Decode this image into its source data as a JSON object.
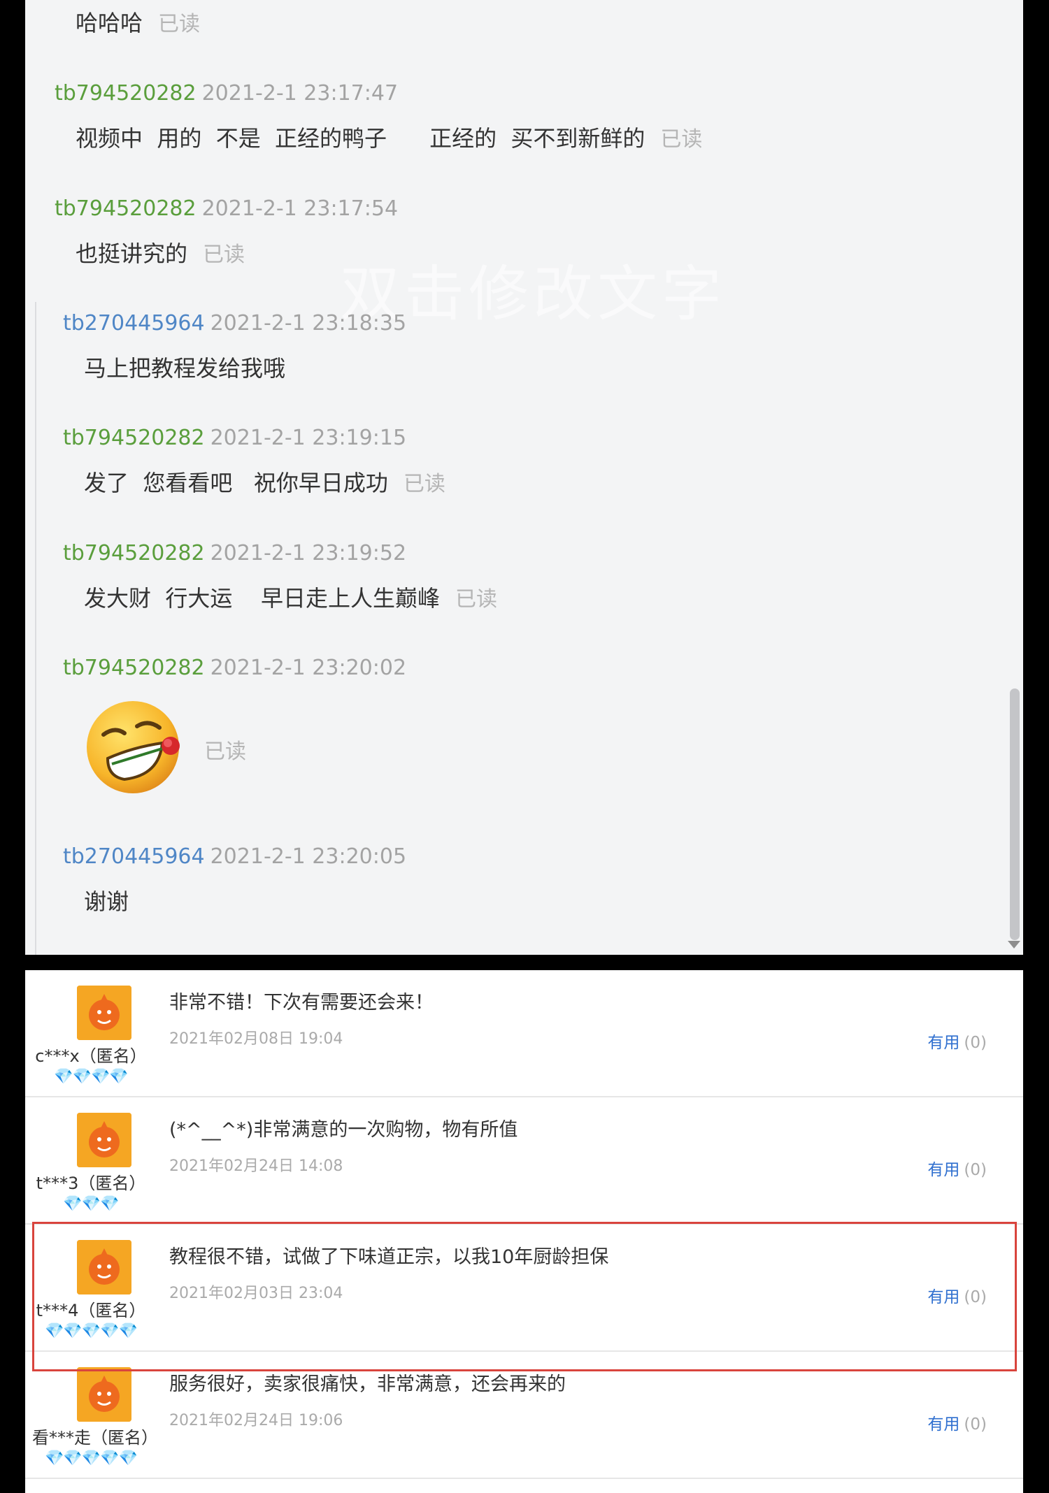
{
  "chat": {
    "watermark": "双击修改文字",
    "top_line": {
      "text": "哈哈哈",
      "read": "已读"
    },
    "messages": [
      {
        "user": "tb794520282",
        "time": "2021-2-1 23:17:47",
        "text": "视频中  用的  不是  正经的鸭子      正经的  买不到新鲜的",
        "read": "已读",
        "color": "#5a9e3c"
      },
      {
        "user": "tb794520282",
        "time": "2021-2-1 23:17:54",
        "text": "也挺讲究的",
        "read": "已读",
        "color": "#5a9e3c"
      },
      {
        "user": "tb270445964",
        "time": "2021-2-1 23:18:35",
        "text": "马上把教程发给我哦",
        "read": "",
        "color": "#4f86c6"
      },
      {
        "user": "tb794520282",
        "time": "2021-2-1 23:19:15",
        "text": "发了  您看看吧   祝你早日成功",
        "read": "已读",
        "color": "#5a9e3c"
      },
      {
        "user": "tb794520282",
        "time": "2021-2-1 23:19:52",
        "text": "发大财  行大运    早日走上人生巅峰",
        "read": "已读",
        "color": "#5a9e3c"
      },
      {
        "user": "tb794520282",
        "time": "2021-2-1 23:20:02",
        "text": "",
        "read": "已读",
        "color": "#5a9e3c",
        "emoji": "grinning-rose-emoji"
      },
      {
        "user": "tb270445964",
        "time": "2021-2-1 23:20:05",
        "text": "谢谢",
        "read": "",
        "color": "#4f86c6"
      }
    ]
  },
  "reviews": {
    "useful_label": "有用",
    "items": [
      {
        "user": "c***x（匿名）",
        "gems": "💎💎💎💎",
        "text": "非常不错！下次有需要还会来！",
        "date": "2021年02月08日 19:04",
        "useful_count": "(0)"
      },
      {
        "user": "t***3（匿名）",
        "gems": "💎💎💎",
        "text": "(*^__^*)非常满意的一次购物，物有所值",
        "date": "2021年02月24日 14:08",
        "useful_count": "(0)"
      },
      {
        "user": "t***4（匿名）",
        "gems": "💎💎💎💎💎",
        "text": "教程很不错，试做了下味道正宗，以我10年厨龄担保",
        "date": "2021年02月03日 23:04",
        "useful_count": "(0)"
      },
      {
        "user": "看***走（匿名）",
        "gems": "💎💎💎💎💎",
        "text": "服务很好，卖家很痛快，非常满意，还会再来的",
        "date": "2021年02月24日 19:06",
        "useful_count": "(0)"
      }
    ]
  }
}
